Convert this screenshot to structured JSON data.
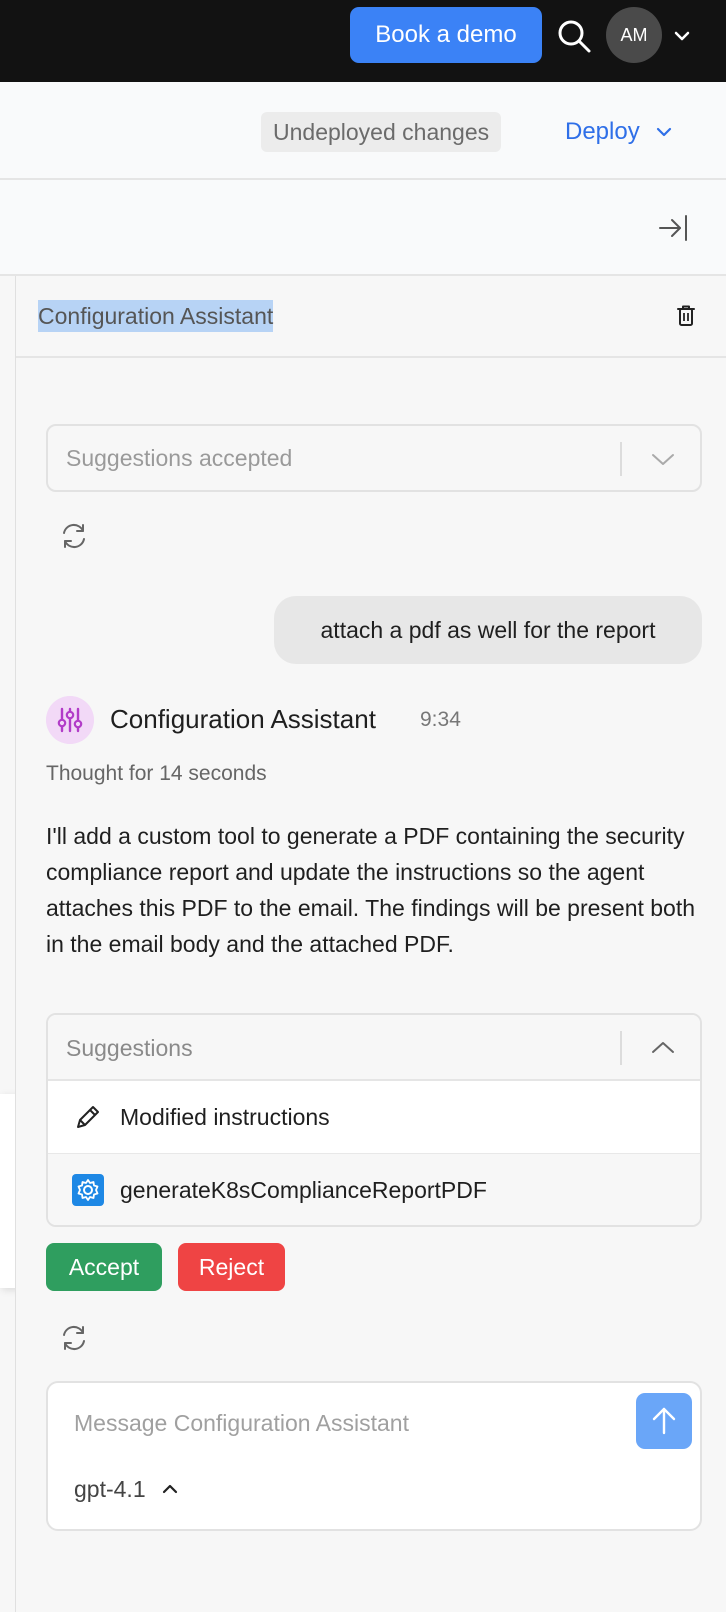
{
  "topbar": {
    "demo_label": "Book a demo",
    "avatar_initials": "AM"
  },
  "deploybar": {
    "status_label": "Undeployed changes",
    "deploy_label": "Deploy"
  },
  "panel": {
    "title": "Configuration Assistant",
    "previous_suggestions_status": "Suggestions accepted"
  },
  "chat": {
    "user_message": "attach a pdf as well for the report",
    "assistant_name": "Configuration Assistant",
    "assistant_time": "9:34",
    "thought_label": "Thought for 14 seconds",
    "assistant_text": "I'll add a custom tool to generate a PDF containing the security compliance report and update the instructions so the agent attaches this PDF to the email. The findings will be present both in the email body and the attached PDF."
  },
  "suggestions": {
    "header": "Suggestions",
    "items": [
      {
        "label": "Modified instructions",
        "icon": "pencil-icon"
      },
      {
        "label": "generateK8sComplianceReportPDF",
        "icon": "gear-icon"
      }
    ],
    "accept_label": "Accept",
    "reject_label": "Reject"
  },
  "composer": {
    "placeholder": "Message Configuration Assistant",
    "model": "gpt-4.1"
  },
  "colors": {
    "accent": "#3b82f6",
    "accept": "#2f9e5f",
    "reject": "#ef4444",
    "deploy_link": "#2f6fe8"
  }
}
